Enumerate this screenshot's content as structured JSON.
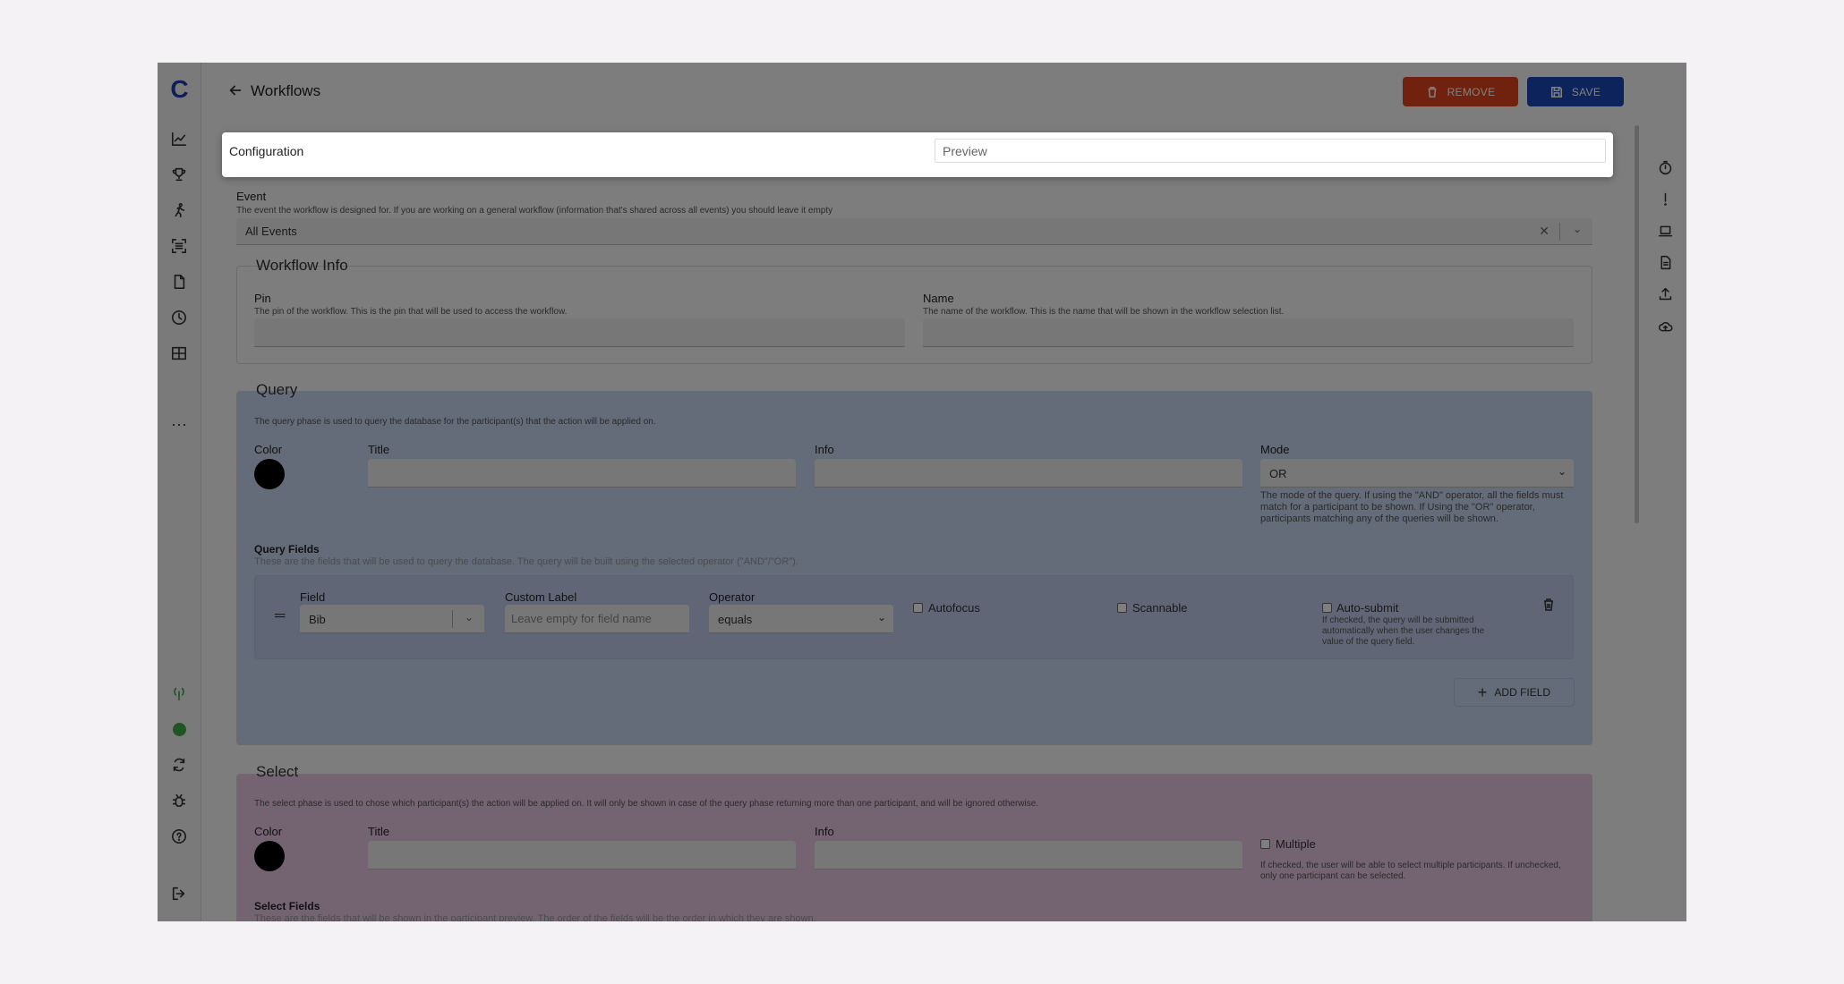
{
  "rail": {
    "logo": "C",
    "more": "...",
    "icons": [
      "chart-line-icon",
      "trophy-icon",
      "runner-icon",
      "scan-icon",
      "file-icon",
      "clock-icon",
      "table-icon"
    ],
    "bottom_icons": [
      "signal-icon",
      "status-online-icon",
      "sync-icon",
      "bug-icon",
      "help-icon",
      "logout-icon"
    ]
  },
  "header": {
    "title": "Workflows",
    "remove_label": "REMOVE",
    "save_label": "SAVE"
  },
  "right_rail": {
    "icons": [
      "timer-icon",
      "alert-icon",
      "laptop-icon",
      "document-icon",
      "upload-icon",
      "cloud-upload-icon"
    ]
  },
  "tabs": {
    "configuration": "Configuration",
    "preview": "Preview"
  },
  "event": {
    "label": "Event",
    "help": "The event the workflow is designed for. If you are working on a general workflow (information that's shared across all events) you should leave it empty",
    "value": "All Events"
  },
  "workflow_info": {
    "legend": "Workflow Info",
    "pin_label": "Pin",
    "pin_help": "The pin of the workflow. This is the pin that will be used to access the workflow.",
    "name_label": "Name",
    "name_help": "The name of the workflow. This is the name that will be shown in the workflow selection list."
  },
  "query": {
    "legend": "Query",
    "help": "The query phase is used to query the database for the participant(s) that the action will be applied on.",
    "color_label": "Color",
    "title_label": "Title",
    "info_label": "Info",
    "mode_label": "Mode",
    "mode_value": "OR",
    "mode_help": "The mode of the query. If using the \"AND\" operator, all the fields must match for a participant to be shown. If Using the \"OR\" operator, participants matching any of the queries will be shown.",
    "fields_title": "Query Fields",
    "fields_help": "These are the fields that will be used to query the database. The query will be built using the selected operator (\"AND\"/\"OR\").",
    "field_row": {
      "field_label": "Field",
      "field_value": "Bib",
      "custom_label": "Custom Label",
      "custom_placeholder": "Leave empty for field name",
      "operator_label": "Operator",
      "operator_value": "equals",
      "autofocus": "Autofocus",
      "scannable": "Scannable",
      "autosubmit": "Auto-submit",
      "autosubmit_help": "If checked, the query will be submitted automatically when the user changes the value of the query field."
    },
    "add_field": "ADD FIELD",
    "bg_color": "#c9d6f2"
  },
  "select": {
    "legend": "Select",
    "help": "The select phase is used to chose which participant(s) the action will be applied on. It will only be shown in case of the query phase returning more than one participant, and will be ignored otherwise.",
    "color_label": "Color",
    "title_label": "Title",
    "info_label": "Info",
    "multiple_label": "Multiple",
    "multiple_help": "If checked, the user will be able to select multiple participants. If unchecked, only one participant can be selected.",
    "fields_title": "Select Fields",
    "fields_help": "These are the fields that will be shown in the participant preview. The order of the fields will be the order in which they are shown.",
    "bg_color": "#e8c8e4"
  },
  "colors": {
    "remove": "#e2451c",
    "save": "#1a47b8",
    "logo": "#1e3fa6",
    "status": "#3faa47"
  }
}
